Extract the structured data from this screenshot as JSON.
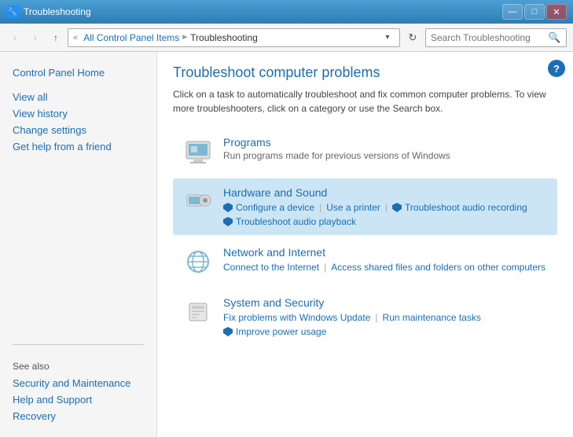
{
  "titlebar": {
    "icon": "🔧",
    "title": "Troubleshooting",
    "minimize": "—",
    "maximize": "□",
    "close": "✕"
  },
  "addressbar": {
    "back": "‹",
    "forward": "›",
    "up": "↑",
    "breadcrumb_root": "All Control Panel Items",
    "breadcrumb_current": "Troubleshooting",
    "search_placeholder": "Search Troubleshooting",
    "search_icon": "🔍",
    "refresh": "↻"
  },
  "sidebar": {
    "control_panel_home": "Control Panel Home",
    "view_all": "View all",
    "view_history": "View history",
    "change_settings": "Change settings",
    "get_help": "Get help from a friend",
    "see_also": "See also",
    "security_maintenance": "Security and Maintenance",
    "help_support": "Help and Support",
    "recovery": "Recovery"
  },
  "content": {
    "title": "Troubleshoot computer problems",
    "description": "Click on a task to automatically troubleshoot and fix common computer problems. To view more troubleshooters, click on a category or use the Search box.",
    "categories": [
      {
        "id": "programs",
        "title": "Programs",
        "description": "Run programs made for previous versions of Windows",
        "links": [],
        "highlighted": false
      },
      {
        "id": "hardware",
        "title": "Hardware and Sound",
        "description": "",
        "links": [
          {
            "text": "Configure a device",
            "shield": true
          },
          {
            "text": "Use a printer",
            "shield": false
          },
          {
            "text": "Troubleshoot audio recording",
            "shield": false
          },
          {
            "text": "Troubleshoot audio playback",
            "shield": false
          }
        ],
        "highlighted": true
      },
      {
        "id": "network",
        "title": "Network and Internet",
        "description": "",
        "links": [
          {
            "text": "Connect to the Internet",
            "shield": false
          },
          {
            "text": "Access shared files and folders on other computers",
            "shield": false
          }
        ],
        "highlighted": false
      },
      {
        "id": "security",
        "title": "System and Security",
        "description": "",
        "links": [
          {
            "text": "Fix problems with Windows Update",
            "shield": false
          },
          {
            "text": "Run maintenance tasks",
            "shield": false
          },
          {
            "text": "Improve power usage",
            "shield": true
          }
        ],
        "highlighted": false
      }
    ],
    "help_tooltip": "?"
  }
}
